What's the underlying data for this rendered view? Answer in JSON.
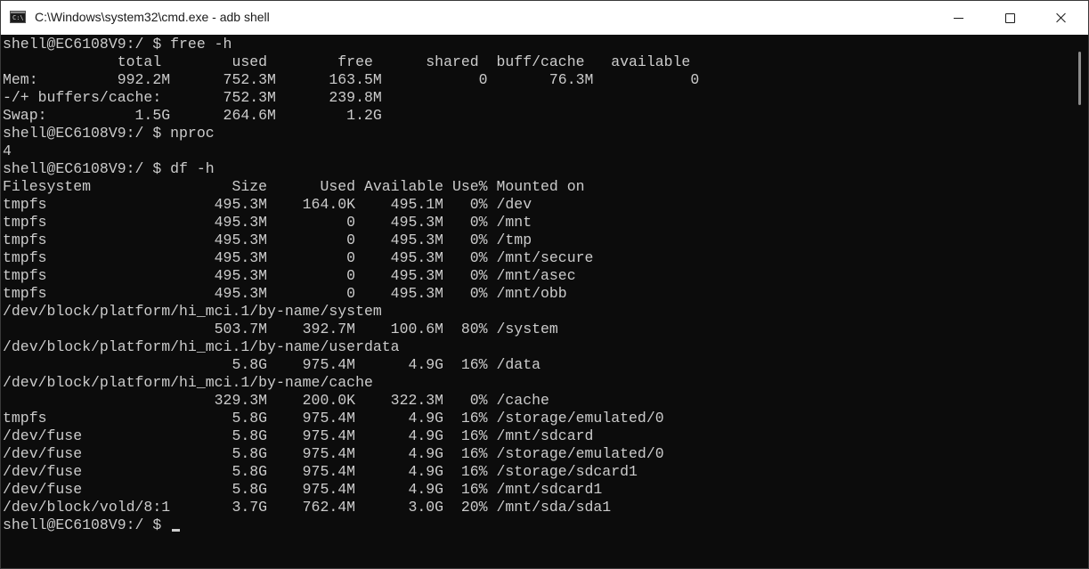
{
  "window": {
    "title": "C:\\Windows\\system32\\cmd.exe - adb  shell",
    "icon": "cmd-icon",
    "icon_text": "C:\\"
  },
  "caption_buttons": {
    "minimize": "minimize-icon",
    "maximize": "maximize-icon",
    "close": "close-icon"
  },
  "console": {
    "lines": [
      "shell@EC6108V9:/ $ free -h",
      "             total        used        free      shared  buff/cache   available",
      "Mem:         992.2M      752.3M      163.5M           0       76.3M           0",
      "-/+ buffers/cache:       752.3M      239.8M",
      "Swap:          1.5G      264.6M        1.2G",
      "shell@EC6108V9:/ $ nproc",
      "4",
      "shell@EC6108V9:/ $ df -h",
      "Filesystem                Size      Used Available Use% Mounted on",
      "tmpfs                   495.3M    164.0K    495.1M   0% /dev",
      "tmpfs                   495.3M         0    495.3M   0% /mnt",
      "tmpfs                   495.3M         0    495.3M   0% /tmp",
      "tmpfs                   495.3M         0    495.3M   0% /mnt/secure",
      "tmpfs                   495.3M         0    495.3M   0% /mnt/asec",
      "tmpfs                   495.3M         0    495.3M   0% /mnt/obb",
      "/dev/block/platform/hi_mci.1/by-name/system",
      "                        503.7M    392.7M    100.6M  80% /system",
      "/dev/block/platform/hi_mci.1/by-name/userdata",
      "                          5.8G    975.4M      4.9G  16% /data",
      "/dev/block/platform/hi_mci.1/by-name/cache",
      "                        329.3M    200.0K    322.3M   0% /cache",
      "tmpfs                     5.8G    975.4M      4.9G  16% /storage/emulated/0",
      "/dev/fuse                 5.8G    975.4M      4.9G  16% /mnt/sdcard",
      "/dev/fuse                 5.8G    975.4M      4.9G  16% /storage/emulated/0",
      "/dev/fuse                 5.8G    975.4M      4.9G  16% /storage/sdcard1",
      "/dev/fuse                 5.8G    975.4M      4.9G  16% /mnt/sdcard1",
      "/dev/block/vold/8:1       3.7G    762.4M      3.0G  20% /mnt/sda/sda1"
    ],
    "prompt": "shell@EC6108V9:/ $ "
  },
  "colors": {
    "background": "#0c0c0c",
    "foreground": "#cccccc",
    "titlebar": "#ffffff"
  }
}
